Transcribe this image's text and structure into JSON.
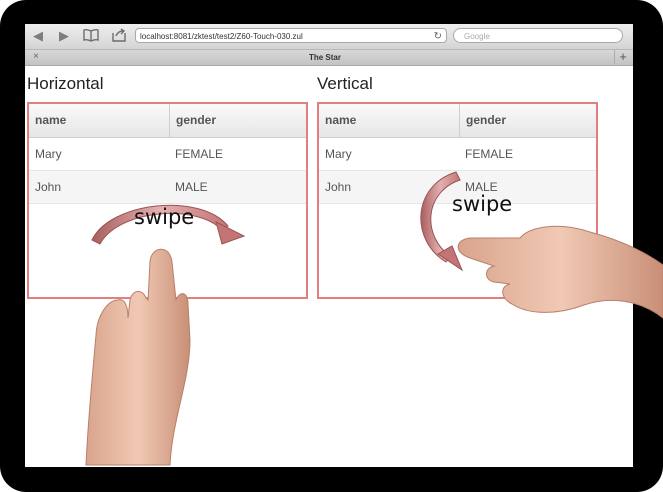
{
  "browser": {
    "url": "localhost:8081/zktest/test2/Z60-Touch-030.zul",
    "search_placeholder": "Google",
    "tab_title": "The Star",
    "tab_close": "×",
    "new_tab": "+"
  },
  "sections": [
    {
      "heading": "Horizontal",
      "columns": [
        "name",
        "gender"
      ],
      "rows": [
        [
          "Mary",
          "FEMALE"
        ],
        [
          "John",
          "MALE"
        ]
      ],
      "gesture_label": "swipe"
    },
    {
      "heading": "Vertical",
      "columns": [
        "name",
        "gender"
      ],
      "rows": [
        [
          "Mary",
          "FEMALE"
        ],
        [
          "John",
          "MALE"
        ]
      ],
      "gesture_label": "swipe"
    }
  ],
  "colors": {
    "grid_border": "#e37e7e",
    "arrow": "#c77575"
  }
}
